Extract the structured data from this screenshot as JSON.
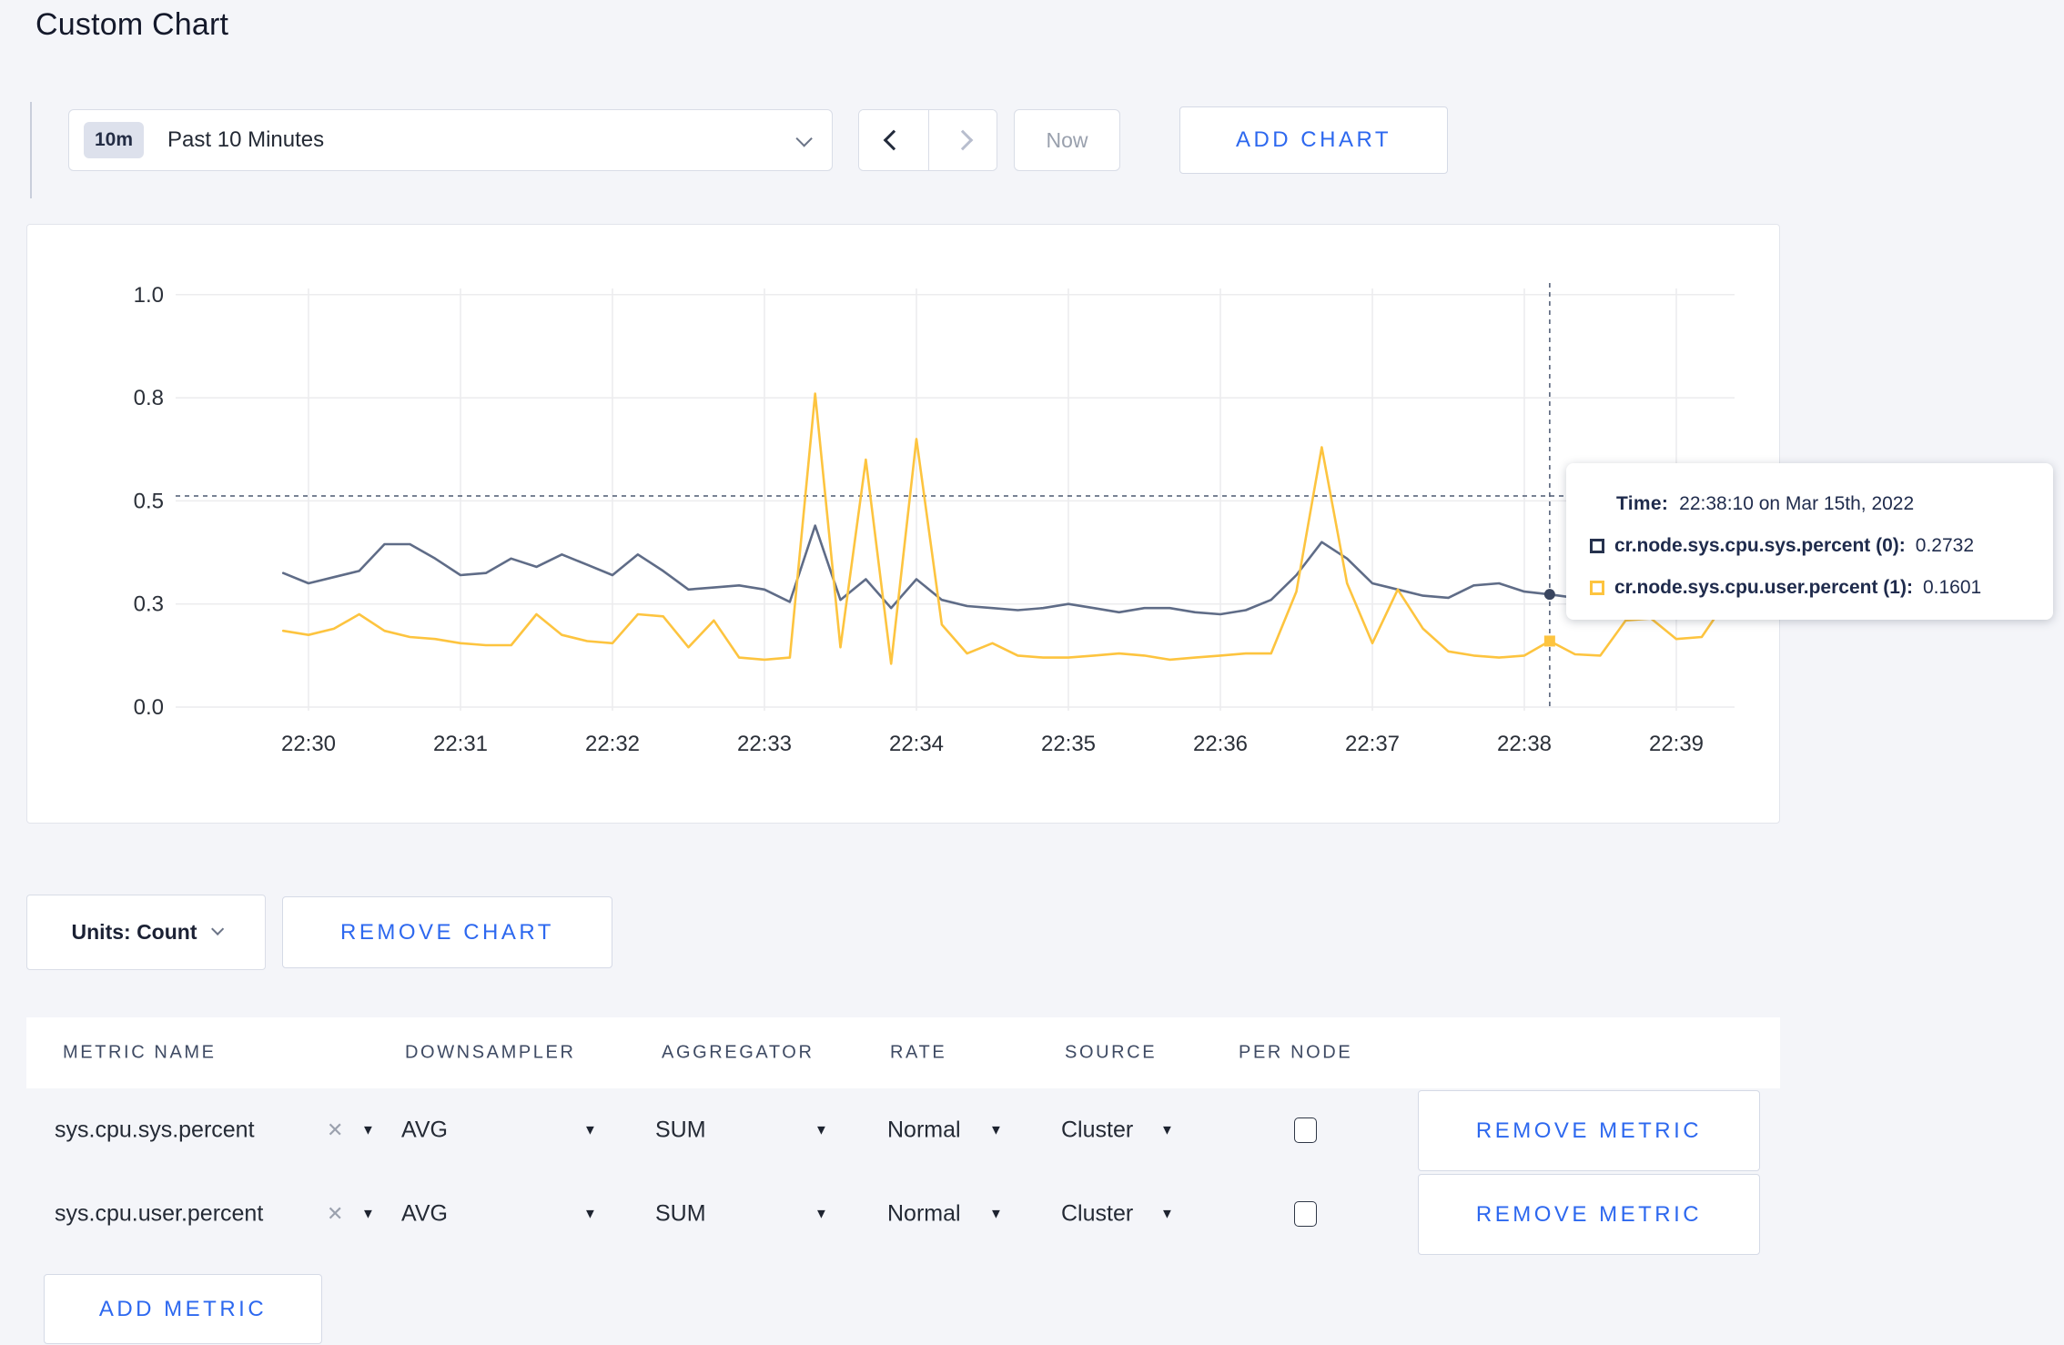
{
  "page": {
    "title": "Custom Chart"
  },
  "icons": {
    "close_x": "✕",
    "caret_down": "▼"
  },
  "toolbar": {
    "time_window": {
      "badge": "10m",
      "label": "Past 10 Minutes"
    },
    "now_label": "Now",
    "add_chart_label": "ADD CHART"
  },
  "chart": {
    "tooltip": {
      "time_label": "Time:",
      "time_value": "22:38:10 on Mar 15th, 2022",
      "series": [
        {
          "name": "cr.node.sys.cpu.sys.percent (0):",
          "value": "0.2732",
          "color": "#26324e"
        },
        {
          "name": "cr.node.sys.cpu.user.percent (1):",
          "value": "0.1601",
          "color": "#fdc43f"
        }
      ]
    }
  },
  "chart_data": {
    "type": "line",
    "title": "",
    "xlabel": "",
    "ylabel": "",
    "ylim": [
      0,
      1
    ],
    "grid": true,
    "legend_position": "none",
    "yticks": {
      "values": [
        0,
        0.25,
        0.5,
        0.75,
        1.0
      ],
      "labels": [
        "0.0",
        "0.3",
        "0.5",
        "0.8",
        "1.0"
      ]
    },
    "xticks": [
      "22:30",
      "22:31",
      "22:32",
      "22:33",
      "22:34",
      "22:35",
      "22:36",
      "22:37",
      "22:38",
      "22:39"
    ],
    "x": [
      "22:29:50",
      "22:30:00",
      "22:30:10",
      "22:30:20",
      "22:30:30",
      "22:30:40",
      "22:30:50",
      "22:31:00",
      "22:31:10",
      "22:31:20",
      "22:31:30",
      "22:31:40",
      "22:31:50",
      "22:32:00",
      "22:32:10",
      "22:32:20",
      "22:32:30",
      "22:32:40",
      "22:32:50",
      "22:33:00",
      "22:33:10",
      "22:33:20",
      "22:33:30",
      "22:33:40",
      "22:33:50",
      "22:34:00",
      "22:34:10",
      "22:34:20",
      "22:34:30",
      "22:34:40",
      "22:34:50",
      "22:35:00",
      "22:35:10",
      "22:35:20",
      "22:35:30",
      "22:35:40",
      "22:35:50",
      "22:36:00",
      "22:36:10",
      "22:36:20",
      "22:36:30",
      "22:36:40",
      "22:36:50",
      "22:37:00",
      "22:37:10",
      "22:37:20",
      "22:37:30",
      "22:37:40",
      "22:37:50",
      "22:38:00",
      "22:38:10",
      "22:38:20",
      "22:38:30",
      "22:38:40",
      "22:38:50",
      "22:39:00",
      "22:39:10",
      "22:39:20"
    ],
    "series": [
      {
        "name": "cr.node.sys.cpu.sys.percent",
        "color": "#5f6c87",
        "values": [
          0.325,
          0.3,
          0.315,
          0.33,
          0.395,
          0.395,
          0.36,
          0.32,
          0.325,
          0.36,
          0.34,
          0.37,
          0.345,
          0.32,
          0.37,
          0.33,
          0.285,
          0.29,
          0.295,
          0.285,
          0.255,
          0.44,
          0.26,
          0.31,
          0.24,
          0.31,
          0.26,
          0.245,
          0.24,
          0.235,
          0.24,
          0.25,
          0.24,
          0.23,
          0.24,
          0.24,
          0.23,
          0.225,
          0.235,
          0.26,
          0.32,
          0.4,
          0.36,
          0.3,
          0.285,
          0.27,
          0.265,
          0.295,
          0.3,
          0.28,
          0.2732,
          0.265,
          0.285,
          0.28,
          0.275,
          0.27,
          0.28,
          0.275
        ]
      },
      {
        "name": "cr.node.sys.cpu.user.percent",
        "color": "#fdc43f",
        "values": [
          0.185,
          0.175,
          0.19,
          0.225,
          0.185,
          0.17,
          0.165,
          0.155,
          0.15,
          0.15,
          0.225,
          0.175,
          0.16,
          0.155,
          0.225,
          0.22,
          0.145,
          0.21,
          0.12,
          0.115,
          0.12,
          0.76,
          0.145,
          0.6,
          0.105,
          0.65,
          0.2,
          0.13,
          0.155,
          0.125,
          0.12,
          0.12,
          0.125,
          0.13,
          0.125,
          0.115,
          0.12,
          0.125,
          0.13,
          0.13,
          0.28,
          0.63,
          0.3,
          0.155,
          0.285,
          0.19,
          0.135,
          0.125,
          0.12,
          0.125,
          0.1601,
          0.128,
          0.125,
          0.21,
          0.215,
          0.165,
          0.17,
          0.26
        ]
      }
    ],
    "crosshair": {
      "x_time": "22:38:10",
      "hover_index": 50,
      "hline_value": 0.512,
      "marker_values": {
        "sys": 0.2732,
        "user": 0.1601
      }
    }
  },
  "controls": {
    "units_label": "Units: Count",
    "remove_chart_label": "REMOVE CHART",
    "add_metric_label": "ADD METRIC",
    "remove_metric_label": "REMOVE METRIC"
  },
  "metrics": {
    "headers": [
      "METRIC NAME",
      "DOWNSAMPLER",
      "AGGREGATOR",
      "RATE",
      "SOURCE",
      "PER NODE"
    ],
    "rows": [
      {
        "name": "sys.cpu.sys.percent",
        "downsampler": "AVG",
        "aggregator": "SUM",
        "rate": "Normal",
        "source": "Cluster",
        "per_node": false
      },
      {
        "name": "sys.cpu.user.percent",
        "downsampler": "AVG",
        "aggregator": "SUM",
        "rate": "Normal",
        "source": "Cluster",
        "per_node": false
      }
    ]
  },
  "colors": {
    "accent_blue": "#2d68ef",
    "line_sys": "#5f6c87",
    "line_user": "#fdc43f",
    "gridline": "#ececee",
    "crosshair": "#4b5871",
    "page_bg": "#f4f5f9"
  }
}
